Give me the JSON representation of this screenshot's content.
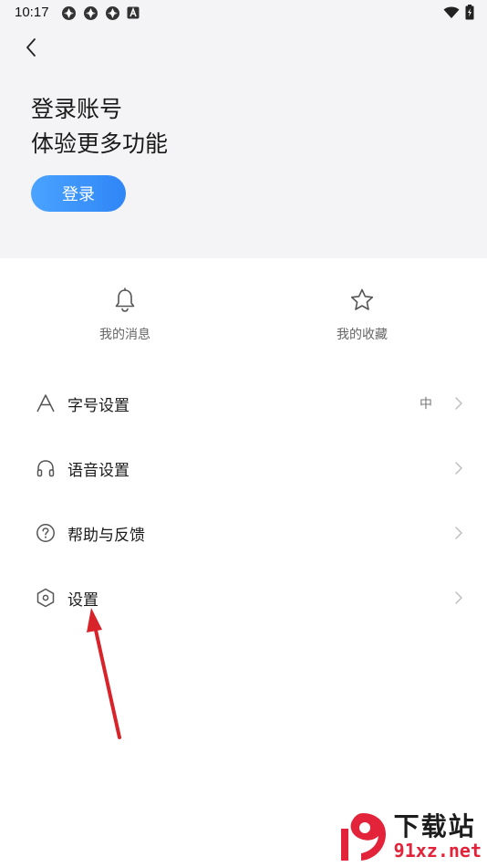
{
  "status_bar": {
    "time": "10:17"
  },
  "header": {
    "headline_line1": "登录账号",
    "headline_line2": "体验更多功能",
    "login_button_label": "登录"
  },
  "quick_entries": [
    {
      "label": "我的消息",
      "icon": "bell-icon"
    },
    {
      "label": "我的收藏",
      "icon": "star-icon"
    }
  ],
  "menu_items": [
    {
      "label": "字号设置",
      "value": "中",
      "icon": "font-size-icon"
    },
    {
      "label": "语音设置",
      "value": "",
      "icon": "headphones-icon"
    },
    {
      "label": "帮助与反馈",
      "value": "",
      "icon": "help-circle-icon"
    },
    {
      "label": "设置",
      "value": "",
      "icon": "hexagon-settings-icon"
    }
  ],
  "watermark": {
    "title": "下载站",
    "url": "91xz.net"
  },
  "colors": {
    "accent": "#3a93fa",
    "header_bg": "#f4f4f6",
    "annotation_arrow": "#d8232a",
    "watermark_red": "#e2233a"
  }
}
